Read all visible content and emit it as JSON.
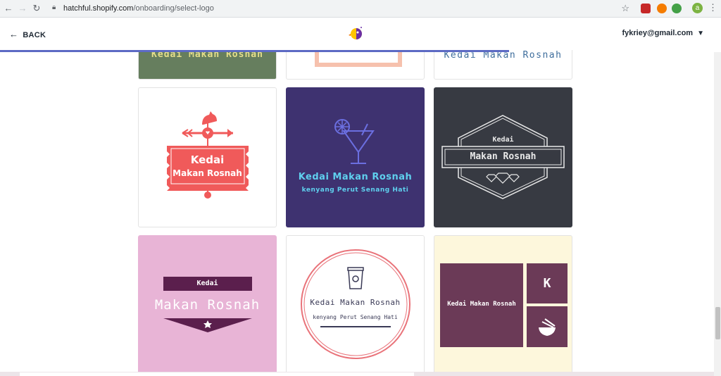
{
  "browser": {
    "url_host": "hatchful.shopify.com",
    "url_path": "/onboarding/select-logo",
    "profile_initial": "a"
  },
  "header": {
    "back_label": "BACK",
    "user_email": "fykriey@gmail.com"
  },
  "logos": {
    "top_row": [
      "Kedai Makan Rosnah",
      "Kedai Makan Rosnah"
    ],
    "card1": {
      "line1": "Kedai",
      "line2": "Makan Rosnah"
    },
    "card2": {
      "title": "Kedai Makan Rosnah",
      "tagline": "kenyang Perut Senang Hati"
    },
    "card3": {
      "line1": "Kedai",
      "line2": "Makan Rosnah"
    },
    "card4": {
      "line1": "Kedai",
      "line2": "Makan Rosnah"
    },
    "card5": {
      "title": "Kedai Makan Rosnah",
      "tagline": "kenyang Perut Senang Hati"
    },
    "card6": {
      "title": "Kedai Makan Rosnah",
      "letter": "K"
    }
  },
  "colors": {
    "accent": "#5c6ac4",
    "coral": "#f05a5a",
    "navy_purple": "#3e3270",
    "charcoal": "#373a42",
    "pink": "#e8b4d6",
    "plum": "#5b1f4d",
    "cream": "#fdf7dc",
    "mauve": "#6b3a57"
  }
}
